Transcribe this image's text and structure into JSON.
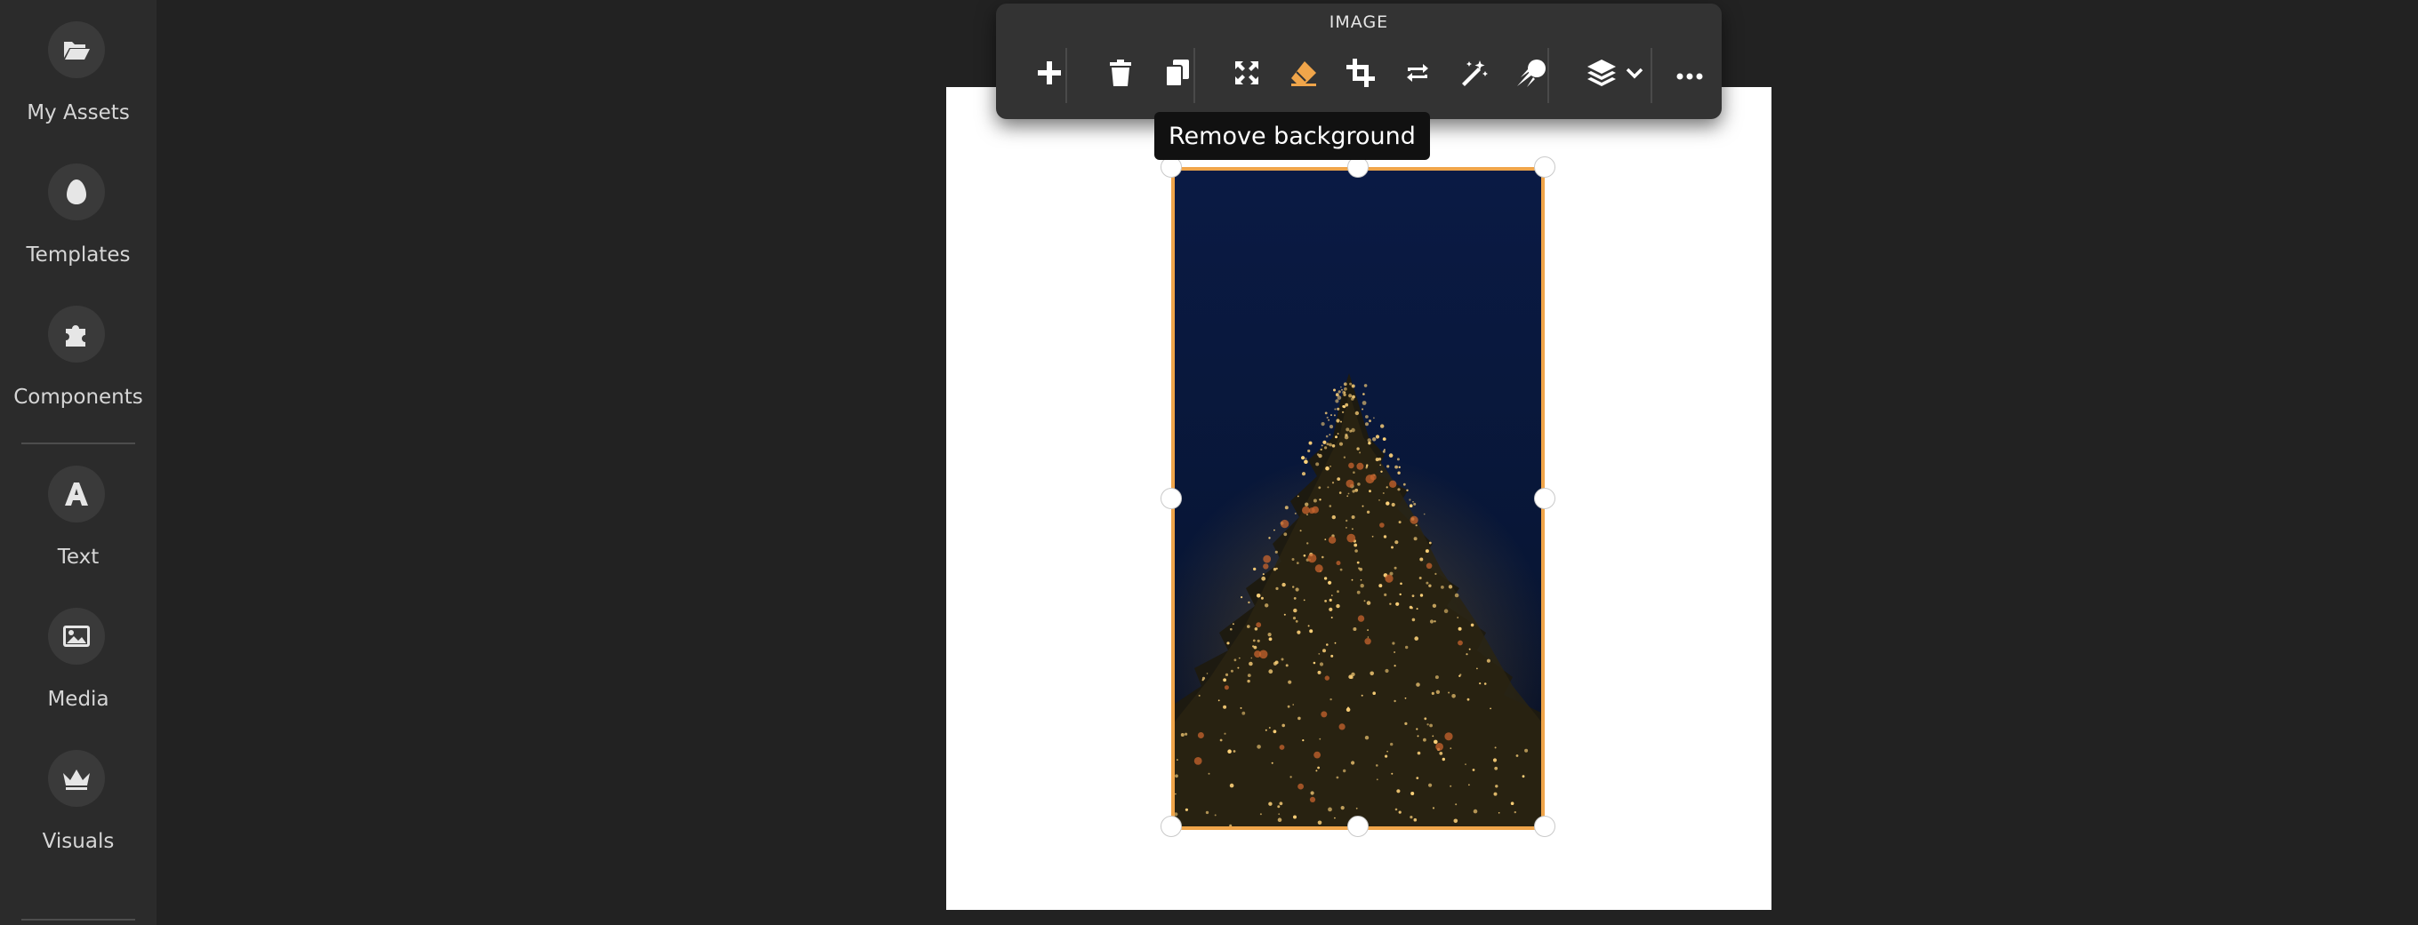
{
  "sidebar": {
    "items": [
      {
        "label": "My Assets",
        "icon": "folder-open-icon"
      },
      {
        "label": "Templates",
        "icon": "egg-icon"
      },
      {
        "label": "Components",
        "icon": "puzzle-icon"
      },
      {
        "label": "Text",
        "icon": "letter-a-icon"
      },
      {
        "label": "Media",
        "icon": "image-icon"
      },
      {
        "label": "Visuals",
        "icon": "crown-icon"
      }
    ]
  },
  "toolbar": {
    "title": "IMAGE",
    "buttons": [
      {
        "name": "add",
        "icon": "plus-icon"
      },
      {
        "name": "delete",
        "icon": "trash-icon"
      },
      {
        "name": "duplicate",
        "icon": "copy-icon"
      },
      {
        "name": "fit",
        "icon": "expand-icon"
      },
      {
        "name": "remove-background",
        "icon": "eraser-icon",
        "active": true
      },
      {
        "name": "crop",
        "icon": "crop-icon"
      },
      {
        "name": "replace",
        "icon": "repeat-icon"
      },
      {
        "name": "magic",
        "icon": "magic-wand-icon"
      },
      {
        "name": "effects",
        "icon": "meteor-icon"
      },
      {
        "name": "layers",
        "icon": "layers-icon"
      },
      {
        "name": "more",
        "icon": "ellipsis-icon"
      }
    ]
  },
  "tooltip": {
    "text": "Remove background"
  },
  "colors": {
    "background": "#222222",
    "sidebar": "#2b2b2b",
    "toolbar": "#333333",
    "accent": "#f0a54a",
    "page": "#ffffff"
  }
}
